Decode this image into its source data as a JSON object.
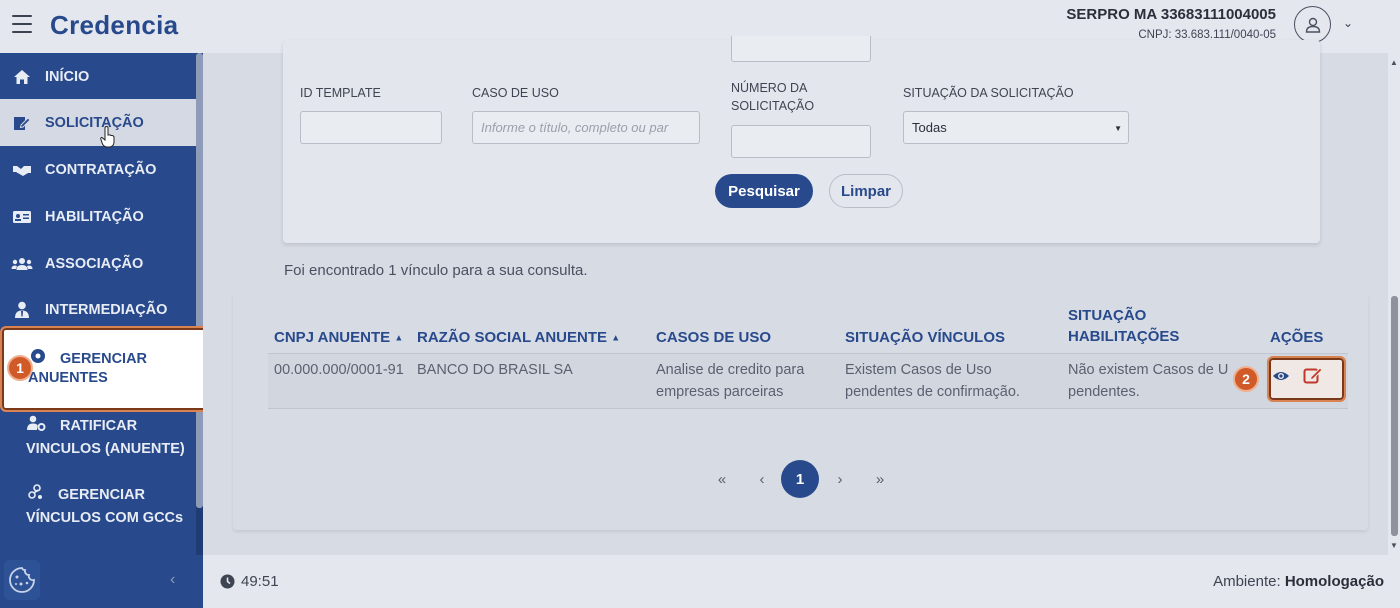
{
  "header": {
    "logo": "Credencia",
    "org_name": "SERPRO MA 33683111004005",
    "org_cnpj": "CNPJ: 33.683.111/0040-05"
  },
  "sidebar": {
    "items": [
      {
        "label": "INÍCIO",
        "icon": "home-icon"
      },
      {
        "label": "SOLICITAÇÃO",
        "icon": "edit-document-icon"
      },
      {
        "label": "CONTRATAÇÃO",
        "icon": "handshake-icon"
      },
      {
        "label": "HABILITAÇÃO",
        "icon": "id-card-icon"
      },
      {
        "label": "ASSOCIAÇÃO",
        "icon": "users-icon"
      },
      {
        "label": "INTERMEDIAÇÃO",
        "icon": "user-tie-icon"
      }
    ],
    "highlight": {
      "line1": "GERENCIAR",
      "line2": "ANUENTES"
    },
    "sub_items": [
      {
        "line1": "RATIFICAR",
        "line2": "VINCULOS (ANUENTE)"
      },
      {
        "line1": "GERENCIAR",
        "line2": "VÍNCULOS COM GCCs"
      }
    ]
  },
  "steps": {
    "one": "1",
    "two": "2"
  },
  "filters": {
    "id_template_label": "ID TEMPLATE",
    "caso_uso_label": "CASO DE USO",
    "caso_uso_placeholder": "Informe o título, completo ou par",
    "numero_label_1": "NÚMERO DA",
    "numero_label_2": "SOLICITAÇÃO",
    "situacao_label": "SITUAÇÃO DA SOLICITAÇÃO",
    "situacao_value": "Todas",
    "search_button": "Pesquisar",
    "clear_button": "Limpar"
  },
  "result_message": "Foi encontrado 1 vínculo para a sua consulta.",
  "table": {
    "headers": {
      "cnpj": "CNPJ ANUENTE",
      "razao": "RAZÃO SOCIAL ANUENTE",
      "casos": "CASOS DE USO",
      "situacao_vinculos": "SITUAÇÃO VÍNCULOS",
      "situacao_hab_1": "SITUAÇÃO",
      "situacao_hab_2": "HABILITAÇÕES",
      "acoes": "AÇÕES"
    },
    "rows": [
      {
        "cnpj": "00.000.000/0001-91",
        "razao": "BANCO DO BRASIL SA",
        "casos_1": "Analise de credito para",
        "casos_2": "empresas parceiras",
        "vinc_1": "Existem Casos de Uso",
        "vinc_2": "pendentes de confirmação.",
        "hab_1": "Não existem Casos de U",
        "hab_2": "pendentes."
      }
    ]
  },
  "pagination": {
    "first": "«",
    "prev": "‹",
    "current": "1",
    "next": "›",
    "last": "»"
  },
  "footer": {
    "timer": "49:51",
    "env_label": "Ambiente:",
    "env_value": "Homologação"
  },
  "colors": {
    "primary": "#284a8c",
    "accent": "#d05a28"
  }
}
